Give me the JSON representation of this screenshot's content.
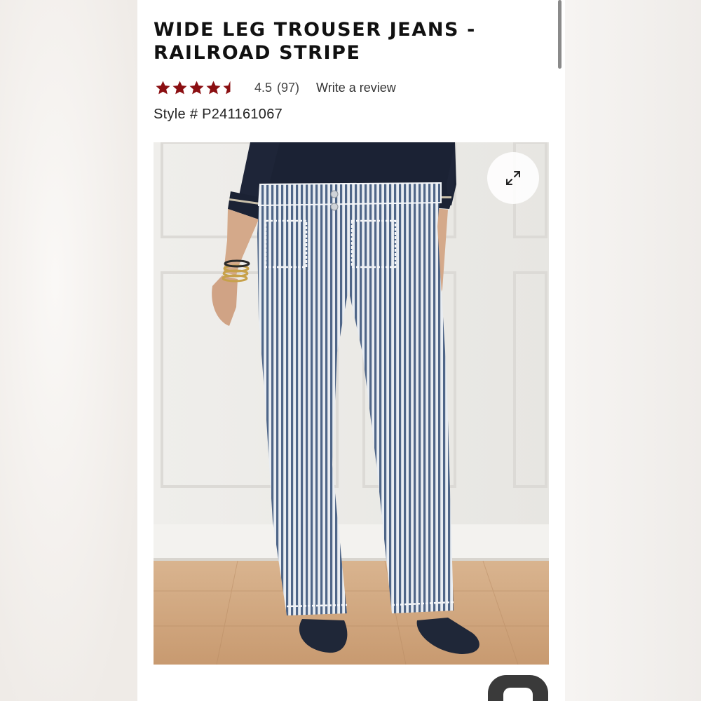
{
  "product": {
    "title": "WIDE LEG TROUSER JEANS - RAILROAD STRIPE",
    "rating_value": "4.5",
    "rating_count": "(97)",
    "rating_stars": 4.5,
    "write_review": "Write a review",
    "style_number": "Style # P241161067"
  },
  "image": {
    "expand_icon": "expand-arrows-icon"
  },
  "chat": {
    "icon": "chat-bubble-icon"
  },
  "colors": {
    "star": "#8b0f12",
    "title": "#111111",
    "chat_button": "#3a3a3a"
  }
}
